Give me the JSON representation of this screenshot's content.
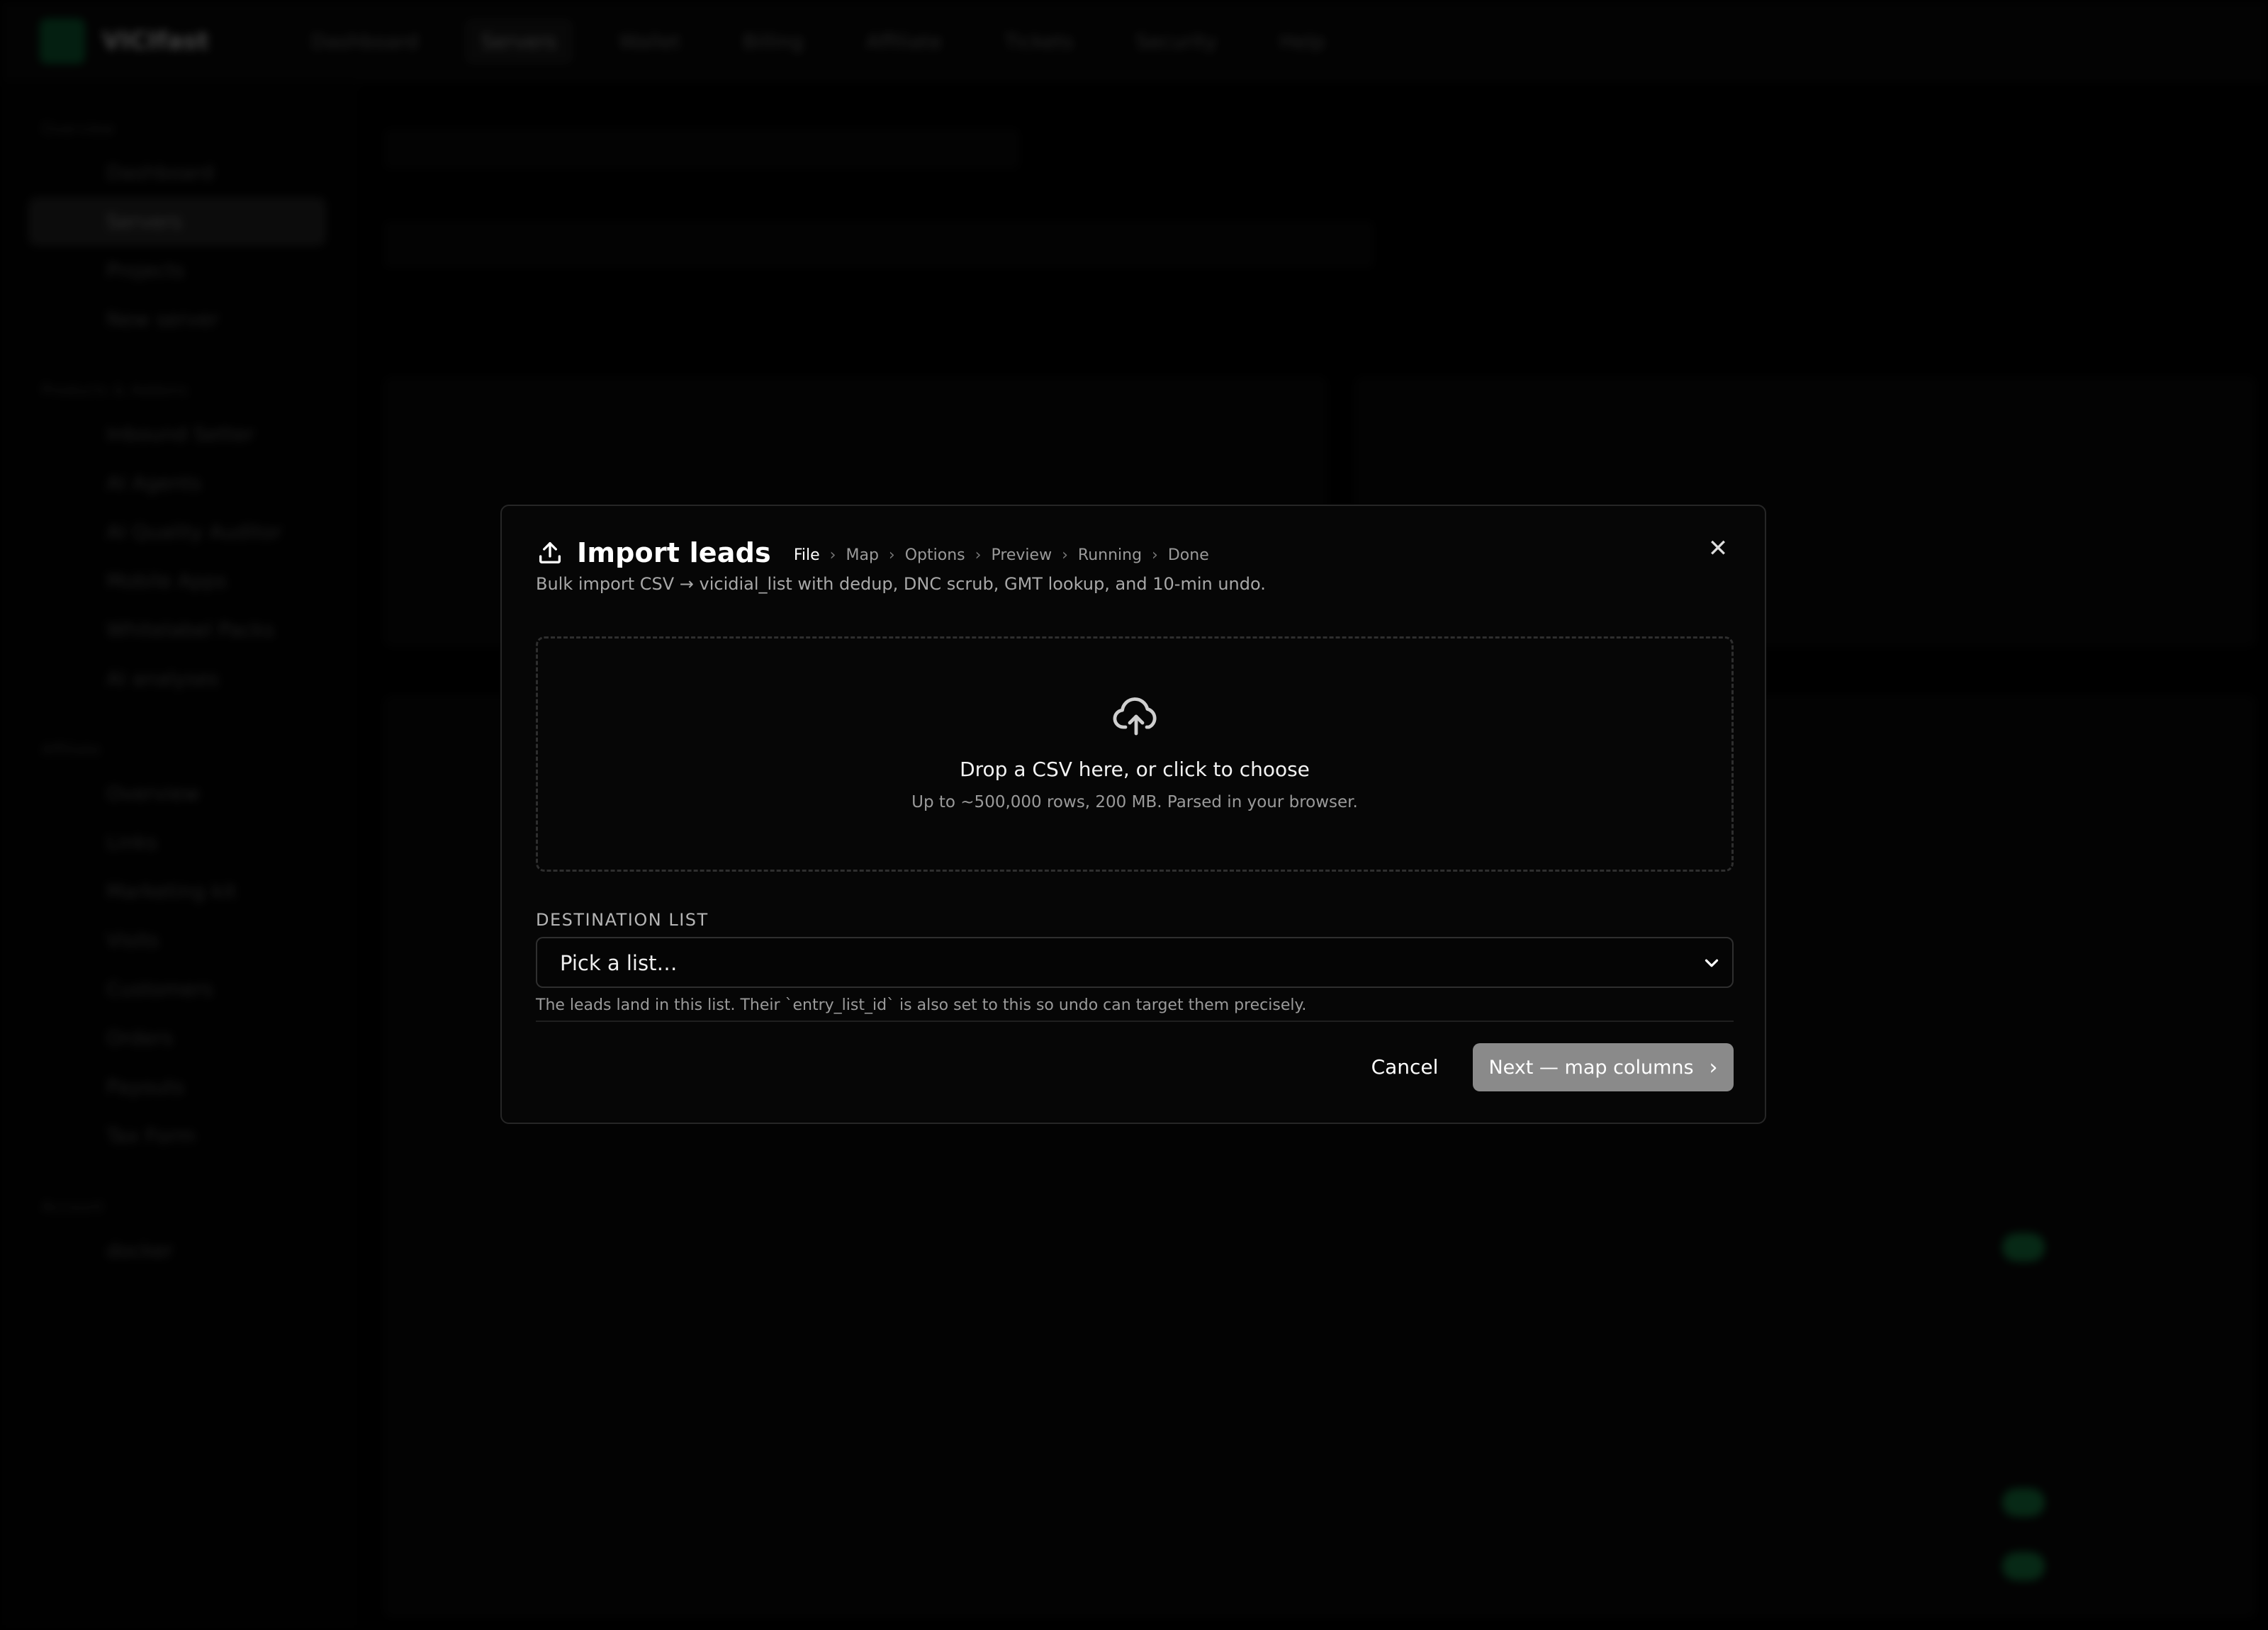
{
  "background": {
    "brand": "VICIfast",
    "topnav": [
      "Dashboard",
      "Servers",
      "Wallet",
      "Billing",
      "Affiliate",
      "Tickets",
      "Security",
      "Help"
    ],
    "topnav_active": "Servers",
    "new_server": "New server",
    "sidebar_sections": [
      {
        "heading": "Overview",
        "items": [
          "Dashboard",
          "Servers",
          "Projects",
          "New server"
        ]
      },
      {
        "heading": "Products & Addons",
        "items": [
          "Inbound Setter",
          "AI Agents",
          "AI Quality Auditor",
          "Mobile Apps",
          "Whitelabel Packs",
          "AI analyses"
        ]
      },
      {
        "heading": "Affiliate",
        "items": [
          "Overview",
          "Links",
          "Marketing kit",
          "Visits",
          "Customers",
          "Orders",
          "Payouts",
          "Tax Form"
        ]
      },
      {
        "heading": "Account",
        "items": [
          "docker"
        ]
      }
    ],
    "sidebar_active": "Servers"
  },
  "modal": {
    "title": "Import leads",
    "steps": [
      "File",
      "Map",
      "Options",
      "Preview",
      "Running",
      "Done"
    ],
    "current_step": "File",
    "subtitle": "Bulk import CSV → vicidial_list with dedup, DNC scrub, GMT lookup, and 10-min undo.",
    "dropzone": {
      "title": "Drop a CSV here, or click to choose",
      "subtitle": "Up to ~500,000 rows, 200 MB. Parsed in your browser."
    },
    "destination": {
      "label": "DESTINATION LIST",
      "value": "Pick a list…",
      "help": "The leads land in this list. Their `entry_list_id` is also set to this so undo can target them precisely."
    },
    "cancel_label": "Cancel",
    "next_label": "Next — map columns",
    "close_icon": "close-icon"
  }
}
